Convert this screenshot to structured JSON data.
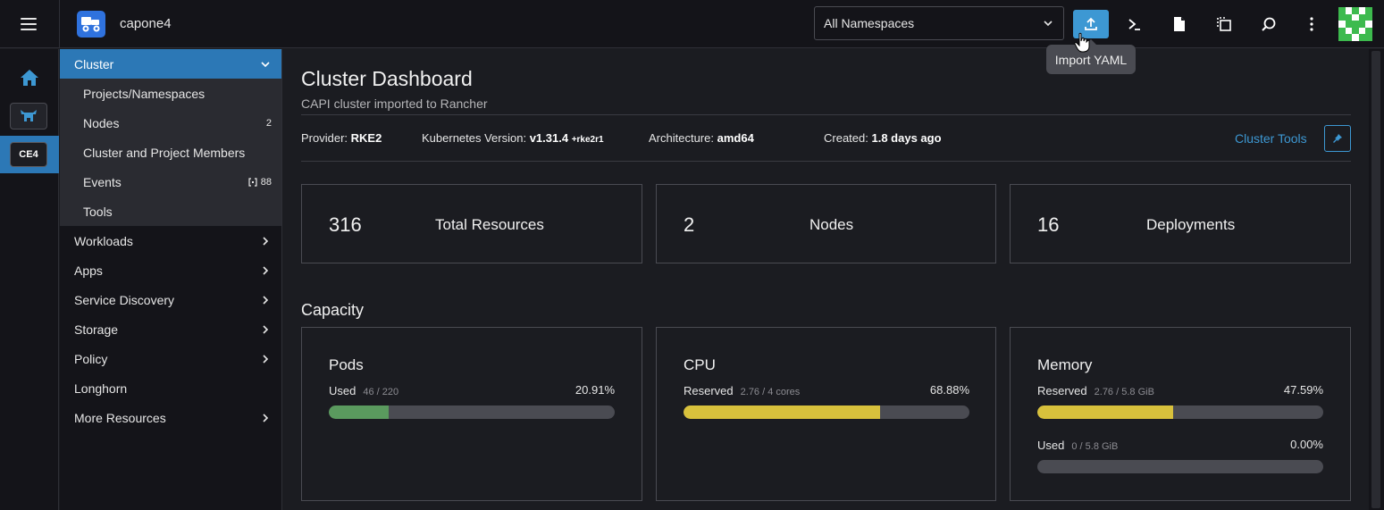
{
  "header": {
    "cluster_name": "capone4",
    "namespace_select": "All Namespaces",
    "tooltip": "Import YAML",
    "buttons": [
      "import-yaml",
      "kubectl-shell",
      "kubeconfig-file",
      "copy-kubeconfig",
      "search",
      "more-actions"
    ]
  },
  "rail": {
    "active_cluster_badge": "CE4"
  },
  "nav": {
    "cluster_label": "Cluster",
    "cluster_items": [
      {
        "label": "Projects/Namespaces",
        "count": ""
      },
      {
        "label": "Nodes",
        "count": "2"
      },
      {
        "label": "Cluster and Project Members",
        "count": ""
      },
      {
        "label": "Events",
        "count": "88"
      },
      {
        "label": "Tools",
        "count": ""
      }
    ],
    "groups": [
      {
        "label": "Workloads",
        "expandable": true
      },
      {
        "label": "Apps",
        "expandable": true
      },
      {
        "label": "Service Discovery",
        "expandable": true
      },
      {
        "label": "Storage",
        "expandable": true
      },
      {
        "label": "Policy",
        "expandable": true
      },
      {
        "label": "Longhorn",
        "expandable": false
      },
      {
        "label": "More Resources",
        "expandable": true
      }
    ]
  },
  "dashboard": {
    "title": "Cluster Dashboard",
    "subtitle": "CAPI cluster imported to Rancher",
    "provider_label": "Provider:",
    "provider": "RKE2",
    "k8s_label": "Kubernetes Version:",
    "k8s_version": "v1.31.4",
    "k8s_suffix": "+rke2r1",
    "arch_label": "Architecture:",
    "arch": "amd64",
    "created_label": "Created:",
    "created": "1.8 days ago",
    "tools_link": "Cluster Tools"
  },
  "stats": [
    {
      "value": "316",
      "label": "Total Resources"
    },
    {
      "value": "2",
      "label": "Nodes"
    },
    {
      "value": "16",
      "label": "Deployments"
    }
  ],
  "capacity": {
    "title": "Capacity",
    "pods": {
      "title": "Pods",
      "label": "Used",
      "detail": "46 / 220",
      "percent": "20.91%",
      "fraction": 0.2091
    },
    "cpu": {
      "title": "CPU",
      "label": "Reserved",
      "detail": "2.76 / 4 cores",
      "percent": "68.88%",
      "fraction": 0.6888
    },
    "memory": {
      "title": "Memory",
      "reserved": {
        "label": "Reserved",
        "detail": "2.76 / 5.8 GiB",
        "percent": "47.59%",
        "fraction": 0.4759
      },
      "used": {
        "label": "Used",
        "detail": "0 / 5.8 GiB",
        "percent": "0.00%",
        "fraction": 0.0
      }
    }
  },
  "colors": {
    "accent": "#3d98d3",
    "nav_active": "#2c78b6",
    "bar_green": "#5a9a5e",
    "bar_yellow": "#d8c13c",
    "bar_track": "#4a4b52"
  }
}
